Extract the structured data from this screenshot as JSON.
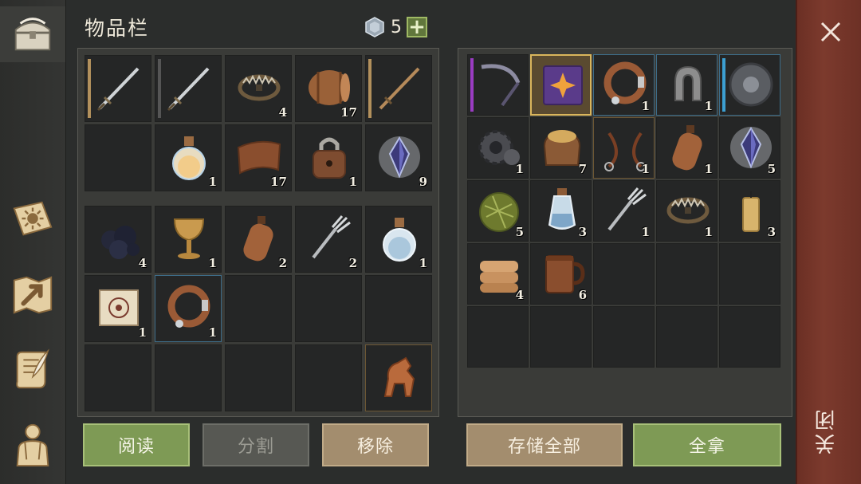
{
  "header": {
    "title": "物品栏",
    "gem_count": "5",
    "plus_label": "+"
  },
  "sidebar": {
    "tabs": [
      {
        "name": "chest-tab",
        "icon": "chest-icon",
        "active": true
      },
      {
        "name": "skills-tab",
        "icon": "sun-book-icon",
        "active": false
      },
      {
        "name": "map-tab",
        "icon": "map-arrow-icon",
        "active": false
      },
      {
        "name": "quest-tab",
        "icon": "scroll-quill-icon",
        "active": false
      },
      {
        "name": "character-tab",
        "icon": "character-icon",
        "active": false
      }
    ]
  },
  "inventory": {
    "rows": [
      [
        {
          "item": "sword-icon",
          "qty": "",
          "bar": "#b2905c"
        },
        {
          "item": "sword-icon",
          "qty": "",
          "bar": "#555"
        },
        {
          "item": "bear-trap-icon",
          "qty": "4"
        },
        {
          "item": "barrel-icon",
          "qty": "17"
        },
        {
          "item": "wooden-sword-icon",
          "qty": "",
          "bar": "#b2905c"
        }
      ],
      [
        {
          "item": "",
          "qty": ""
        },
        {
          "item": "potion-icon",
          "qty": "1"
        },
        {
          "item": "leather-icon",
          "qty": "17"
        },
        {
          "item": "padlock-icon",
          "qty": "1"
        },
        {
          "item": "crystal-icon",
          "qty": "9"
        }
      ],
      [
        {
          "item": "coal-icon",
          "qty": "4"
        },
        {
          "item": "goblet-icon",
          "qty": "1"
        },
        {
          "item": "flask-icon",
          "qty": "2"
        },
        {
          "item": "fork-icon",
          "qty": "2"
        },
        {
          "item": "water-potion-icon",
          "qty": "1"
        }
      ],
      [
        {
          "item": "scroll-map-icon",
          "qty": "1"
        },
        {
          "item": "collar-icon",
          "qty": "1",
          "style": "sel-blue"
        },
        {
          "item": "",
          "qty": ""
        },
        {
          "item": "",
          "qty": ""
        },
        {
          "item": "",
          "qty": ""
        }
      ],
      [
        {
          "item": "",
          "qty": ""
        },
        {
          "item": "",
          "qty": ""
        },
        {
          "item": "",
          "qty": ""
        },
        {
          "item": "",
          "qty": ""
        },
        {
          "item": "horse-figurine-icon",
          "qty": "",
          "style": "gold-dim"
        }
      ]
    ],
    "buttons": {
      "read": "阅读",
      "split": "分割",
      "remove": "移除"
    }
  },
  "storage": {
    "rows": [
      [
        {
          "item": "scythe-icon",
          "qty": "",
          "bar": "#9a3cc2"
        },
        {
          "item": "spellbook-icon",
          "qty": "",
          "style": "sel-gold-bright"
        },
        {
          "item": "collar-icon",
          "qty": "1",
          "style": "sel-blue"
        },
        {
          "item": "horseshoe-icon",
          "qty": "1",
          "style": "sel-blue"
        },
        {
          "item": "shield-icon",
          "qty": "",
          "style": "sel-blue",
          "bar": "#3c9fd1"
        }
      ],
      [
        {
          "item": "gear-icon",
          "qty": "1"
        },
        {
          "item": "grain-sack-icon",
          "qty": "7"
        },
        {
          "item": "reins-icon",
          "qty": "1",
          "style": "gold-dim"
        },
        {
          "item": "flask-icon",
          "qty": "1"
        },
        {
          "item": "crystal-icon",
          "qty": "5"
        }
      ],
      [
        {
          "item": "herb-ball-icon",
          "qty": "5"
        },
        {
          "item": "water-flask-icon",
          "qty": "3"
        },
        {
          "item": "fork-icon",
          "qty": "1"
        },
        {
          "item": "bear-trap-icon",
          "qty": "1"
        },
        {
          "item": "candle-icon",
          "qty": "3"
        }
      ],
      [
        {
          "item": "cloth-icon",
          "qty": "4"
        },
        {
          "item": "mug-icon",
          "qty": "6"
        },
        {
          "item": "",
          "qty": ""
        },
        {
          "item": "",
          "qty": ""
        },
        {
          "item": "",
          "qty": ""
        }
      ],
      [
        {
          "item": "",
          "qty": ""
        },
        {
          "item": "",
          "qty": ""
        },
        {
          "item": "",
          "qty": ""
        },
        {
          "item": "",
          "qty": ""
        },
        {
          "item": "",
          "qty": ""
        }
      ]
    ],
    "buttons": {
      "store_all": "存储全部",
      "take_all": "全拿"
    }
  },
  "close": {
    "label": "关闭"
  }
}
